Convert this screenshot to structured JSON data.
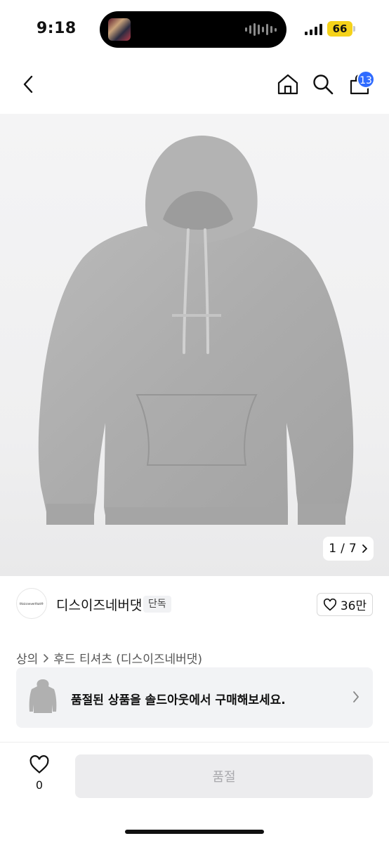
{
  "status_bar": {
    "time": "9:18",
    "battery": "66",
    "battery_color": "#f5d21a"
  },
  "nav": {
    "back_icon": "chevron-left-icon",
    "home_icon": "home-icon",
    "search_icon": "search-icon",
    "cart_icon": "shopping-bag-icon",
    "cart_count": "13",
    "badge_color": "#2f6bff"
  },
  "product": {
    "image_counter_current": "1",
    "image_counter_separator": "/",
    "image_counter_total": "7"
  },
  "brand": {
    "logo_text": "thisisneverthat®",
    "name": "디스이즈네버댓",
    "tag": "단독",
    "likes": "36만"
  },
  "breadcrumb": {
    "category": "상의",
    "subcategory": "후드 티셔츠 (디스이즈네버댓)"
  },
  "soldout_banner": {
    "text": "품절된 상품을 솔드아웃에서 구매해보세요."
  },
  "bottom_bar": {
    "wish_count": "0",
    "buy_label": "품절"
  }
}
